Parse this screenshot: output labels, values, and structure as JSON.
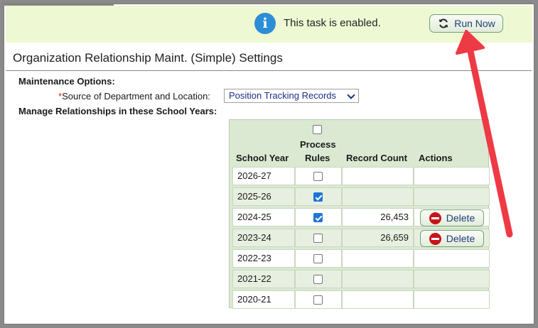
{
  "banner": {
    "message": "This task is enabled.",
    "run_label": "Run Now"
  },
  "page": {
    "title": "Organization Relationship Maint. (Simple) Settings"
  },
  "options": {
    "heading": "Maintenance Options:",
    "source_label": "Source of Department and Location:",
    "required_mark": "*",
    "source_value": "Position Tracking Records",
    "manage_heading": "Manage Relationships in these School Years:"
  },
  "table": {
    "headers": {
      "school_year": "School Year",
      "process_rules_line1": "Process",
      "process_rules_line2": "Rules",
      "record_count": "Record Count",
      "actions": "Actions"
    },
    "select_all_checked": false,
    "delete_label": "Delete",
    "rows": [
      {
        "year": "2026-27",
        "checked": false,
        "count": "",
        "delete": false
      },
      {
        "year": "2025-26",
        "checked": true,
        "count": "",
        "delete": false
      },
      {
        "year": "2024-25",
        "checked": true,
        "count": "26,453",
        "delete": true
      },
      {
        "year": "2023-24",
        "checked": false,
        "count": "26,659",
        "delete": true
      },
      {
        "year": "2022-23",
        "checked": false,
        "count": "",
        "delete": false
      },
      {
        "year": "2021-22",
        "checked": false,
        "count": "",
        "delete": false
      },
      {
        "year": "2020-21",
        "checked": false,
        "count": "",
        "delete": false
      }
    ]
  },
  "colors": {
    "banner_bg": "#eef9d3",
    "grid_bg": "#dbe9d3",
    "annotation_arrow": "#ee3a45",
    "delete_icon": "#c9141b"
  }
}
